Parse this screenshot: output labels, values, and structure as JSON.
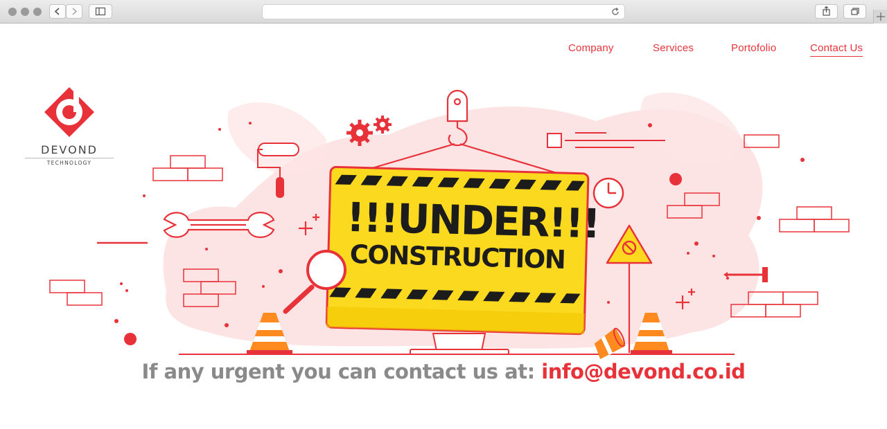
{
  "nav": {
    "items": [
      "Company",
      "Services",
      "Portofolio",
      "Contact Us"
    ]
  },
  "brand": {
    "name": "DEVOND",
    "tagline": "TECHNOLOGY",
    "logo_icon": "devond-d-diamond-logo"
  },
  "sign": {
    "line1": "!!!UNDER!!!",
    "line2": "CONSTRUCTION"
  },
  "contact": {
    "lead": "If any urgent you can contact us at:",
    "email": "info@devond.co.id"
  },
  "colors": {
    "accent": "#e8323a",
    "sign_yellow": "#fbd91e",
    "blob_pink": "#fde3e3",
    "text_gray": "#8a8a8a"
  },
  "icons": [
    "back-icon",
    "forward-icon",
    "sidebar-icon",
    "reload-icon",
    "share-icon",
    "tabs-icon",
    "new-tab-icon"
  ]
}
